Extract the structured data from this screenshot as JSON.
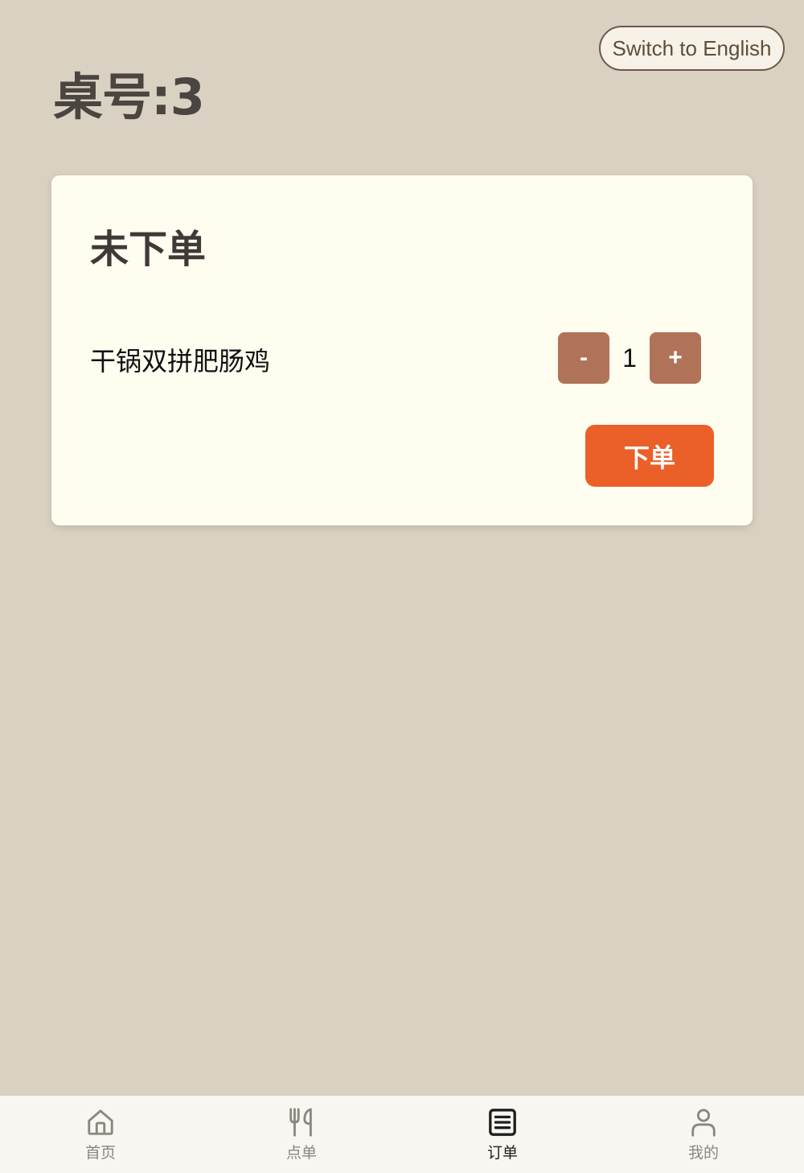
{
  "header": {
    "language_toggle": "Switch to English",
    "table_number": "桌号:3"
  },
  "order": {
    "status_title": "未下单",
    "items": [
      {
        "name": "干锅双拼肥肠鸡",
        "minus": "-",
        "quantity": "1",
        "plus": "+"
      }
    ],
    "submit_label": "下单"
  },
  "tabbar": {
    "active": "订单",
    "tabs": [
      {
        "label": "首页",
        "icon": "home-icon"
      },
      {
        "label": "点单",
        "icon": "fork-knife-icon"
      },
      {
        "label": "订单",
        "icon": "order-list-icon"
      },
      {
        "label": "我的",
        "icon": "user-icon"
      }
    ]
  },
  "colors": {
    "background": "#d9d2c2",
    "card": "#fffcf0",
    "qty_button": "#b07357",
    "submit_button": "#eb5f29",
    "tabbar": "#f8f6f0"
  }
}
